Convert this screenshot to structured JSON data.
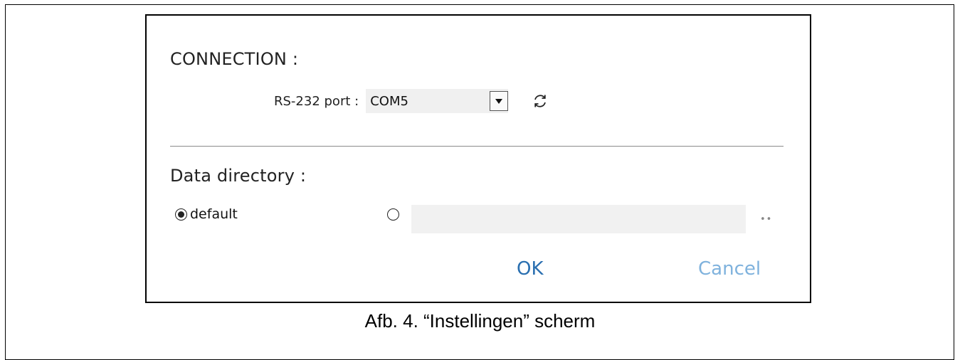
{
  "dialog": {
    "connection": {
      "title": "CONNECTION :",
      "port_label": "RS-232 port :",
      "port_value": "COM5"
    },
    "data_directory": {
      "title": "Data directory :",
      "default_option_label": "default",
      "default_selected": true,
      "custom_selected": false,
      "custom_path_value": "",
      "browse_label": "••"
    },
    "buttons": {
      "ok_label": "OK",
      "cancel_label": "Cancel"
    }
  },
  "caption": "Afb. 4. “Instellingen” scherm",
  "colors": {
    "ok": "#2a6fb0",
    "cancel": "#7fb2dd",
    "input_bg": "#f1f1f1"
  },
  "icons": {
    "dropdown": "chevron-down-icon",
    "refresh": "refresh-icon"
  }
}
